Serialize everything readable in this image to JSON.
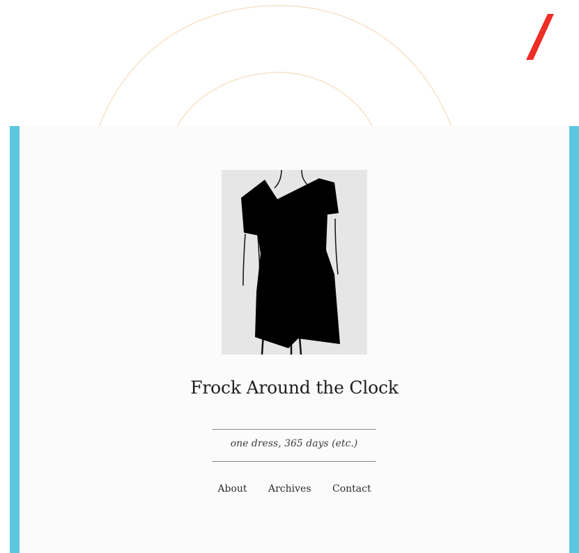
{
  "site": {
    "title": "Frock Around the Clock",
    "tagline": "one dress, 365 days (etc.)"
  },
  "nav": {
    "items": [
      {
        "label": "About"
      },
      {
        "label": "Archives"
      },
      {
        "label": "Contact"
      }
    ]
  },
  "colors": {
    "frame": "#5cc8e0",
    "panel": "#fbfbfb",
    "arc": "#f8e2c8",
    "slash": "#ee2d24",
    "dress": "#000000",
    "image_bg": "#e6e6e6"
  },
  "icons": {
    "logo_mark": "red-slash-icon",
    "header_image": "black-dress-illustration"
  }
}
